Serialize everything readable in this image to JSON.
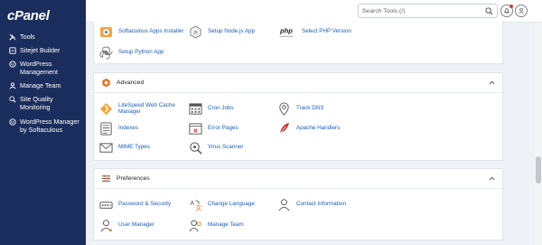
{
  "brand": {
    "logo": "cPanel"
  },
  "sidebar": {
    "items": [
      {
        "label": "Tools",
        "icon": "wrench-icon"
      },
      {
        "label": "Sitejet Builder",
        "icon": "sitejet-icon"
      },
      {
        "label": "WordPress Management",
        "icon": "wordpress-icon"
      },
      {
        "label": "Manage Team",
        "icon": "team-icon"
      },
      {
        "label": "Site Quality Monitoring",
        "icon": "monitor-icon"
      },
      {
        "label": "WordPress Manager by Softaculous",
        "icon": "wordpress-icon"
      }
    ]
  },
  "topbar": {
    "search_placeholder": "Search Tools (/)"
  },
  "software": {
    "items": [
      {
        "label": "Softaculous Apps Installer",
        "icon": "softaculous-icon"
      },
      {
        "label": "Setup Node.js App",
        "icon": "nodejs-icon"
      },
      {
        "label": "Select PHP Version",
        "icon": "php-icon"
      },
      {
        "label": "Setup Python App",
        "icon": "python-icon"
      }
    ]
  },
  "advanced": {
    "title": "Advanced",
    "items": [
      {
        "label": "LiteSpeed Web Cache Manager",
        "icon": "litespeed-icon"
      },
      {
        "label": "Cron Jobs",
        "icon": "calendar-icon"
      },
      {
        "label": "Track DNS",
        "icon": "location-icon"
      },
      {
        "label": "Indexes",
        "icon": "index-icon"
      },
      {
        "label": "Error Pages",
        "icon": "error-page-icon"
      },
      {
        "label": "Apache Handlers",
        "icon": "feather-icon"
      },
      {
        "label": "MIME Types",
        "icon": "mime-icon"
      },
      {
        "label": "Virus Scanner",
        "icon": "scanner-icon"
      }
    ]
  },
  "preferences": {
    "title": "Preferences",
    "items": [
      {
        "label": "Password & Security",
        "icon": "password-icon"
      },
      {
        "label": "Change Language",
        "icon": "language-icon"
      },
      {
        "label": "Contact Information",
        "icon": "contact-icon"
      },
      {
        "label": "User Manager",
        "icon": "user-icon"
      },
      {
        "label": "Manage Team",
        "icon": "team-icon"
      }
    ]
  },
  "colors": {
    "sidebar": "#1b2d5c",
    "link": "#1c5db4",
    "accent": "#e96d1f"
  }
}
